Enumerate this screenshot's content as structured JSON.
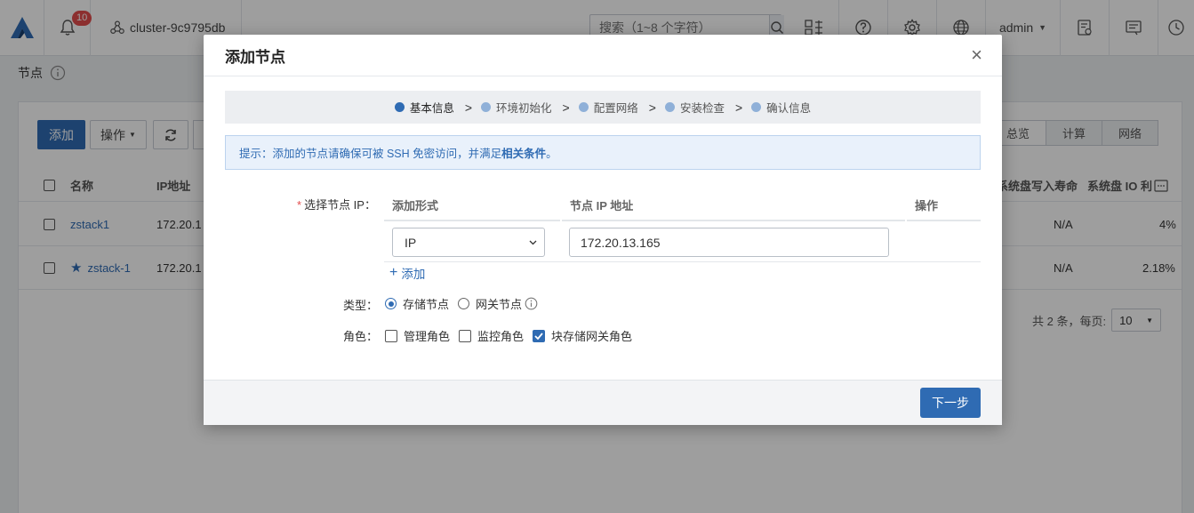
{
  "topbar": {
    "notification_count": "10",
    "cluster_name": "cluster-9c9795db",
    "search_placeholder": "搜索（1~8 个字符）",
    "user": "admin"
  },
  "page": {
    "title": "节点",
    "toolbar": {
      "add_label": "添加",
      "operation_label": "操作"
    },
    "view_tabs": [
      "总览",
      "计算",
      "网络"
    ],
    "table": {
      "headers": [
        "名称",
        "IP地址",
        "系统盘写入寿命",
        "系统盘 IO 利"
      ],
      "rows": [
        {
          "name": "zstack1",
          "ip": "172.20.1",
          "life": "N/A",
          "io": "4%"
        },
        {
          "name": "zstack-1",
          "ip": "172.20.1",
          "life": "N/A",
          "io": "2.18%"
        }
      ]
    },
    "pager": {
      "summary": "共 2 条，每页:",
      "page_size": "10"
    }
  },
  "modal": {
    "title": "添加节点",
    "close_symbol": "×",
    "steps": [
      "基本信息",
      "环境初始化",
      "配置网络",
      "安装检查",
      "确认信息"
    ],
    "active_step": 0,
    "tip_prefix": "提示：添加的节点请确保可被 SSH 免密访问，并满足",
    "tip_link": "相关条件",
    "tip_suffix": "。",
    "ip_label": "选择节点 IP：",
    "ip_table": {
      "headers": [
        "添加形式",
        "节点 IP 地址",
        "操作"
      ],
      "row": {
        "mode": "IP",
        "ip": "172.20.13.165"
      }
    },
    "add_row_label": "添加",
    "type_label": "类型：",
    "type_options": [
      {
        "label": "存储节点",
        "selected": true
      },
      {
        "label": "网关节点",
        "selected": false
      }
    ],
    "role_label": "角色：",
    "role_options": [
      {
        "label": "管理角色",
        "checked": false
      },
      {
        "label": "监控角色",
        "checked": false
      },
      {
        "label": "块存储网关角色",
        "checked": true
      }
    ],
    "next_label": "下一步"
  },
  "colors": {
    "primary": "#2f6bb3",
    "badge": "#e34d4d"
  }
}
